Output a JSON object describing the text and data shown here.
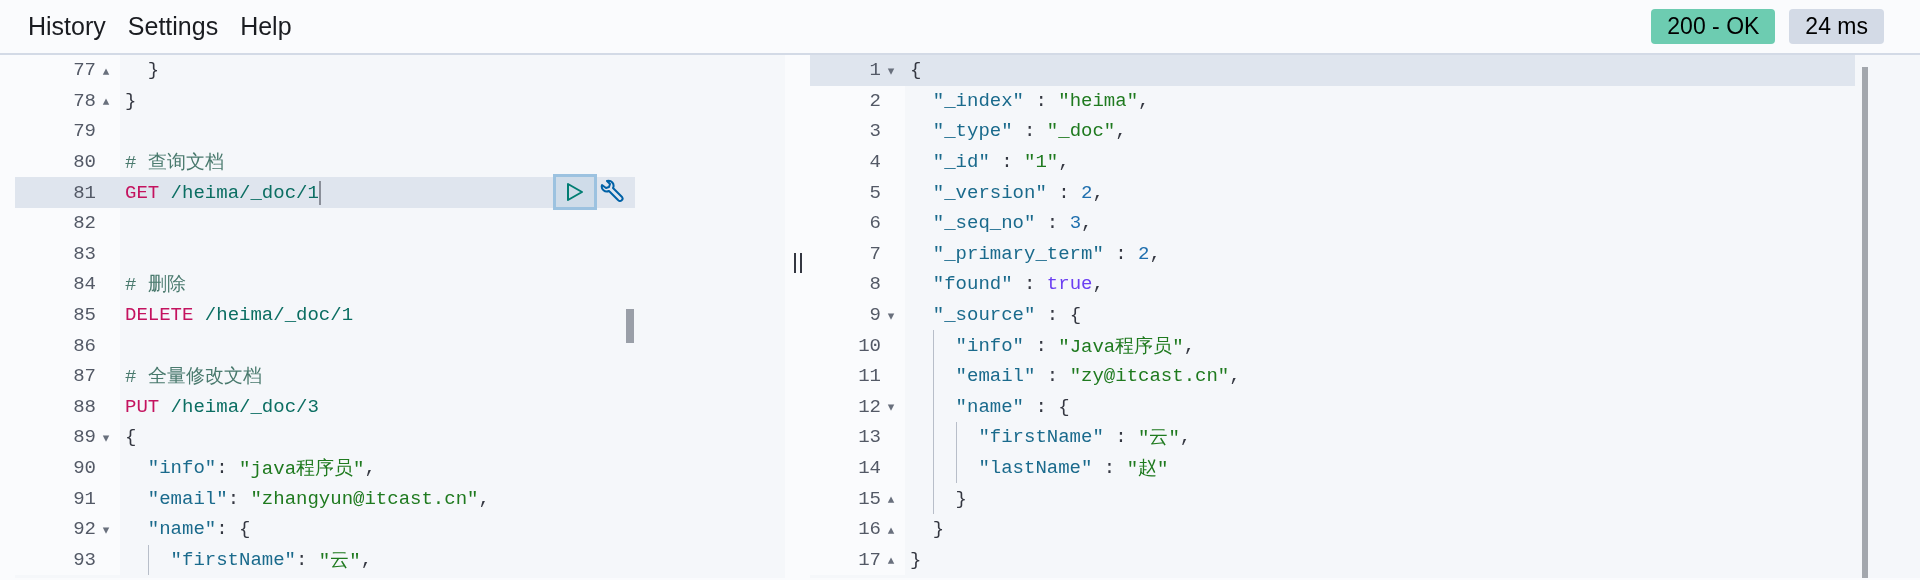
{
  "menu": [
    {
      "label": "History"
    },
    {
      "label": "Settings"
    },
    {
      "label": "Help"
    }
  ],
  "status": {
    "code": "200 - OK",
    "time": "24 ms"
  },
  "request_editor": {
    "lines": [
      {
        "number": "77",
        "fold": "▴",
        "selected": false,
        "tokens": [
          {
            "kind": "punct",
            "text": "  }"
          }
        ]
      },
      {
        "number": "78",
        "fold": "▴",
        "selected": false,
        "tokens": [
          {
            "kind": "punct",
            "text": "}"
          }
        ]
      },
      {
        "number": "79",
        "selected": false
      },
      {
        "number": "80",
        "selected": false,
        "tokens": [
          {
            "kind": "comment",
            "text": "# 查询文档"
          }
        ]
      },
      {
        "number": "81",
        "selected": true,
        "tokens": [
          {
            "kind": "method",
            "text": "GET"
          },
          {
            "kind": "url",
            "text": " /heima/_doc/1"
          }
        ]
      },
      {
        "number": "82",
        "selected": false
      },
      {
        "number": "83",
        "selected": false
      },
      {
        "number": "84",
        "selected": false,
        "tokens": [
          {
            "kind": "comment",
            "text": "# 删除"
          }
        ]
      },
      {
        "number": "85",
        "selected": false,
        "tokens": [
          {
            "kind": "method",
            "text": "DELETE"
          },
          {
            "kind": "url",
            "text": " /heima/_doc/1"
          }
        ]
      },
      {
        "number": "86",
        "selected": false
      },
      {
        "number": "87",
        "selected": false,
        "tokens": [
          {
            "kind": "comment",
            "text": "# 全量修改文档"
          }
        ]
      },
      {
        "number": "88",
        "selected": false,
        "tokens": [
          {
            "kind": "method",
            "text": "PUT"
          },
          {
            "kind": "url",
            "text": " /heima/_doc/3"
          }
        ]
      },
      {
        "number": "89",
        "fold": "▾",
        "selected": false,
        "tokens": [
          {
            "kind": "punct",
            "text": "{"
          }
        ]
      },
      {
        "number": "90",
        "selected": false,
        "tokens": [
          {
            "kind": "key",
            "text": "  \"info\""
          },
          {
            "kind": "punct",
            "text": ": "
          },
          {
            "kind": "string",
            "text": "\"java程序员\""
          },
          {
            "kind": "punct",
            "text": ","
          }
        ]
      },
      {
        "number": "91",
        "selected": false,
        "tokens": [
          {
            "kind": "key",
            "text": "  \"email\""
          },
          {
            "kind": "punct",
            "text": ": "
          },
          {
            "kind": "string",
            "text": "\"zhangyun@itcast.cn\""
          },
          {
            "kind": "punct",
            "text": ","
          }
        ]
      },
      {
        "number": "92",
        "fold": "▾",
        "selected": false,
        "tokens": [
          {
            "kind": "key",
            "text": "  \"name\""
          },
          {
            "kind": "punct",
            "text": ": {"
          }
        ]
      },
      {
        "number": "93",
        "selected": false,
        "tokens": [
          {
            "kind": "key",
            "text": "    \"firstName\""
          },
          {
            "kind": "punct",
            "text": ": "
          },
          {
            "kind": "string",
            "text": "\"云\""
          },
          {
            "kind": "punct",
            "text": ","
          }
        ]
      }
    ]
  },
  "response_viewer": {
    "lines": [
      {
        "number": "1",
        "fold": "▾",
        "selected": true,
        "tokens": [
          {
            "kind": "punct",
            "text": "{"
          }
        ]
      },
      {
        "number": "2",
        "selected": false,
        "tokens": [
          {
            "kind": "key",
            "text": "  \"_index\""
          },
          {
            "kind": "punct",
            "text": " : "
          },
          {
            "kind": "string",
            "text": "\"heima\""
          },
          {
            "kind": "punct",
            "text": ","
          }
        ]
      },
      {
        "number": "3",
        "selected": false,
        "tokens": [
          {
            "kind": "key",
            "text": "  \"_type\""
          },
          {
            "kind": "punct",
            "text": " : "
          },
          {
            "kind": "string",
            "text": "\"_doc\""
          },
          {
            "kind": "punct",
            "text": ","
          }
        ]
      },
      {
        "number": "4",
        "selected": false,
        "tokens": [
          {
            "kind": "key",
            "text": "  \"_id\""
          },
          {
            "kind": "punct",
            "text": " : "
          },
          {
            "kind": "string",
            "text": "\"1\""
          },
          {
            "kind": "punct",
            "text": ","
          }
        ]
      },
      {
        "number": "5",
        "selected": false,
        "tokens": [
          {
            "kind": "key",
            "text": "  \"_version\""
          },
          {
            "kind": "punct",
            "text": " : "
          },
          {
            "kind": "number",
            "text": "2"
          },
          {
            "kind": "punct",
            "text": ","
          }
        ]
      },
      {
        "number": "6",
        "selected": false,
        "tokens": [
          {
            "kind": "key",
            "text": "  \"_seq_no\""
          },
          {
            "kind": "punct",
            "text": " : "
          },
          {
            "kind": "number",
            "text": "3"
          },
          {
            "kind": "punct",
            "text": ","
          }
        ]
      },
      {
        "number": "7",
        "selected": false,
        "tokens": [
          {
            "kind": "key",
            "text": "  \"_primary_term\""
          },
          {
            "kind": "punct",
            "text": " : "
          },
          {
            "kind": "number",
            "text": "2"
          },
          {
            "kind": "punct",
            "text": ","
          }
        ]
      },
      {
        "number": "8",
        "selected": false,
        "tokens": [
          {
            "kind": "key",
            "text": "  \"found\""
          },
          {
            "kind": "punct",
            "text": " : "
          },
          {
            "kind": "bool",
            "text": "true"
          },
          {
            "kind": "punct",
            "text": ","
          }
        ]
      },
      {
        "number": "9",
        "fold": "▾",
        "selected": false,
        "tokens": [
          {
            "kind": "key",
            "text": "  \"_source\""
          },
          {
            "kind": "punct",
            "text": " : {"
          }
        ]
      },
      {
        "number": "10",
        "selected": false,
        "tokens": [
          {
            "kind": "key",
            "text": "    \"info\""
          },
          {
            "kind": "punct",
            "text": " : "
          },
          {
            "kind": "string",
            "text": "\"Java程序员\""
          },
          {
            "kind": "punct",
            "text": ","
          }
        ]
      },
      {
        "number": "11",
        "selected": false,
        "tokens": [
          {
            "kind": "key",
            "text": "    \"email\""
          },
          {
            "kind": "punct",
            "text": " : "
          },
          {
            "kind": "string",
            "text": "\"zy@itcast.cn\""
          },
          {
            "kind": "punct",
            "text": ","
          }
        ]
      },
      {
        "number": "12",
        "fold": "▾",
        "selected": false,
        "tokens": [
          {
            "kind": "key",
            "text": "    \"name\""
          },
          {
            "kind": "punct",
            "text": " : {"
          }
        ]
      },
      {
        "number": "13",
        "selected": false,
        "tokens": [
          {
            "kind": "key",
            "text": "      \"firstName\""
          },
          {
            "kind": "punct",
            "text": " : "
          },
          {
            "kind": "string",
            "text": "\"云\""
          },
          {
            "kind": "punct",
            "text": ","
          }
        ]
      },
      {
        "number": "14",
        "selected": false,
        "tokens": [
          {
            "kind": "key",
            "text": "      \"lastName\""
          },
          {
            "kind": "punct",
            "text": " : "
          },
          {
            "kind": "string",
            "text": "\"赵\""
          }
        ]
      },
      {
        "number": "15",
        "fold": "▴",
        "selected": false,
        "tokens": [
          {
            "kind": "punct",
            "text": "    }"
          }
        ]
      },
      {
        "number": "16",
        "fold": "▴",
        "selected": false,
        "tokens": [
          {
            "kind": "punct",
            "text": "  }"
          }
        ]
      },
      {
        "number": "17",
        "fold": "▴",
        "selected": false,
        "tokens": [
          {
            "kind": "punct",
            "text": "}"
          }
        ]
      }
    ]
  }
}
